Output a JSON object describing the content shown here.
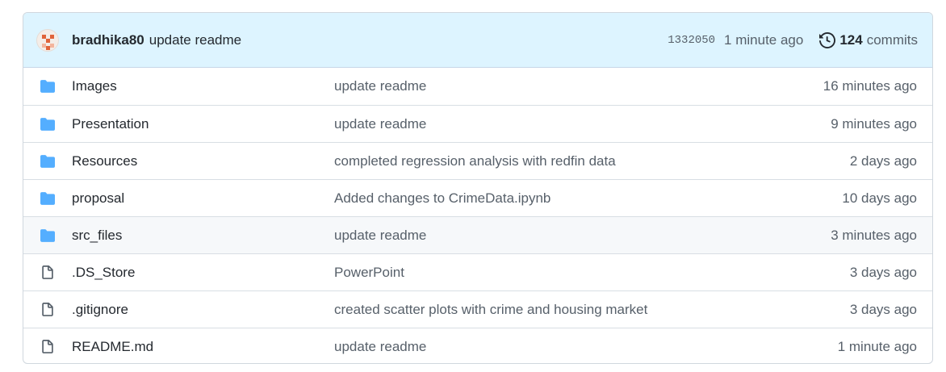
{
  "latest_commit": {
    "author": "bradhika80",
    "message": "update readme",
    "sha": "1332050",
    "time": "1 minute ago",
    "commit_count": "124",
    "commits_label": "commits"
  },
  "colors": {
    "header_bg": "#ddf4ff",
    "folder_icon": "#54aeff",
    "file_icon": "#57606a",
    "row_hover": "#f6f8fa",
    "border": "#d0d7de"
  },
  "files": [
    {
      "type": "folder",
      "icon": "folder-icon",
      "name": "Images",
      "message": "update readme",
      "age": "16 minutes ago"
    },
    {
      "type": "folder",
      "icon": "folder-icon",
      "name": "Presentation",
      "message": "update readme",
      "age": "9 minutes ago"
    },
    {
      "type": "folder",
      "icon": "folder-icon",
      "name": "Resources",
      "message": "completed regression analysis with redfin data",
      "age": "2 days ago"
    },
    {
      "type": "folder",
      "icon": "folder-icon",
      "name": "proposal",
      "message": "Added changes to CrimeData.ipynb",
      "age": "10 days ago"
    },
    {
      "type": "folder",
      "icon": "folder-icon",
      "name": "src_files",
      "message": "update readme",
      "age": "3 minutes ago"
    },
    {
      "type": "file",
      "icon": "file-icon",
      "name": ".DS_Store",
      "message": "PowerPoint",
      "age": "3 days ago"
    },
    {
      "type": "file",
      "icon": "file-icon",
      "name": ".gitignore",
      "message": "created scatter plots with crime and housing market",
      "age": "3 days ago"
    },
    {
      "type": "file",
      "icon": "file-icon",
      "name": "README.md",
      "message": "update readme",
      "age": "1 minute ago"
    }
  ]
}
